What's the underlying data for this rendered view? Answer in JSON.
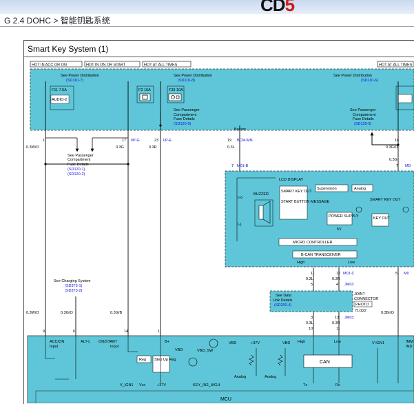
{
  "header": {
    "breadcrumb": "G 2.4 DOHC > 智能钥匙系统"
  },
  "diagram": {
    "title": "Smart Key System (1)",
    "hot_labels": {
      "acc_on": "HOT IN ACC OR ON",
      "on_start": "HOT IN ON OR START",
      "at_all_times_1": "HOT AT ALL TIMES",
      "at_all_times_2": "HOT AT ALL TIMES"
    },
    "power_dist": {
      "see_power_1": "See Power Distribution",
      "ref_1": "(SD110-7)",
      "see_power_2": "See Power Distribution",
      "ref_2": "(SD110-8)",
      "see_power_3": "See Power Distribution",
      "ref_3": "(SD110-6)"
    },
    "fuses": {
      "f11_rating": "F11 7.5A",
      "f11_name": "AUDIO-2",
      "f2_rating": "F2 10A",
      "f33_rating": "F33 10A"
    },
    "passenger": {
      "a1": "See Passenger",
      "a2": "Compartment",
      "a3": "Fuse Details",
      "a_ref": "(SD120-9)",
      "b1": "See Passenger",
      "b2": "Compartment",
      "b3": "Fuse Details",
      "b_ref": "(SD120-9)",
      "c1": "See Passenger",
      "c2": "Compartment",
      "c3": "Fuse Details",
      "c_ref1": "(SD120-1)",
      "c_ref2": "(SD120-2)"
    },
    "pins": {
      "p1": "1",
      "p17": "17",
      "p23": "23",
      "p19": "19",
      "p16": "16",
      "ip_g": "I/P-G",
      "ip_e": "I/P-E",
      "bcm_mn": "BCM-MN",
      "buzzer": "Buzzer",
      "p7": "7",
      "p7b": "7",
      "m01b": "M01-B",
      "md": "MD",
      "p11": "11",
      "p12": "12",
      "p4": "4",
      "p5": "5",
      "m01c": "M01-C",
      "m0": "M0",
      "p3": "3",
      "p13": "13",
      "jm03a": "JM03",
      "jm03b": "JM03",
      "p10": "10",
      "p11b": "11",
      "p9": "9",
      "p6": "6",
      "p14": "14",
      "p1b": "1"
    },
    "wires": {
      "w_03wo_top": "0.3W/O",
      "w_03g": "0.3G",
      "w_03r": "0.3R",
      "w_03l": "0.3L",
      "w_03go": "0.3G/O",
      "w_03g_b": "0.3G",
      "w_03l_b": "0.3L",
      "w_03r_b": "0.3R",
      "w_03l_c": "0.3L",
      "w_03r_c": "0.3R",
      "w_03wo": "0.3W/O",
      "w_03go_b": "0.3G/O",
      "w_03gb": "0.3G/B",
      "w_03brvo": "0.3Br/O"
    },
    "lcd": {
      "title": "LCD DISPLAY",
      "buzzer": "BUZZER",
      "smart_key_out": "SMART KEY OUT",
      "start_button": "START BUTTON MESSAGE",
      "supervision": "Supervision",
      "analog": "Analog",
      "power_supply": "POWER SUPPLY",
      "smart_key": "SMART KEY OUT",
      "key_out": "KEY OUT",
      "five_v": "5V",
      "micro": "MICRO CONTROLLER",
      "bcan": "B-CAN TRANSCEIVER",
      "high": "High",
      "low": "Low",
      "plus": "(+)",
      "minus": "(-)"
    },
    "charging": {
      "see": "See Charging System",
      "r1": "(SD373-1)",
      "r2": "(SD373-2)"
    },
    "joint": {
      "see_data": "See Data",
      "link": "Link Details",
      "ref": "(SD200-4)",
      "joint": "JOINT",
      "connector": "CONNECTOR",
      "photo": "PHOTO",
      "photo_ref": "71/122"
    },
    "mcu": {
      "acc": "ACC/ON",
      "input1": "Input",
      "alt": "ALT-L",
      "onstart": "ON/START",
      "input2": "Input",
      "bplus": "B+",
      "vbd1": "VBD",
      "vbd_sw": "VBD_SW",
      "vbd2": "VBD",
      "plus37": "+37V",
      "vbd3": "VBD",
      "high": "High",
      "low": "Low",
      "vign1": "V-IGN1",
      "imm": "IMM",
      "ind": "IND",
      "reg": "Reg",
      "stepup": "Step Up Reg",
      "can": "CAN",
      "vign1_label": "V_IGN1",
      "vcc": "Vcc",
      "plus37b": "+37V",
      "key_in": "KEY_IN2_HIGH",
      "analog1": "Analog",
      "analog2": "Analog",
      "tx": "Tx",
      "rx": "Rx",
      "label": "MCU"
    }
  }
}
